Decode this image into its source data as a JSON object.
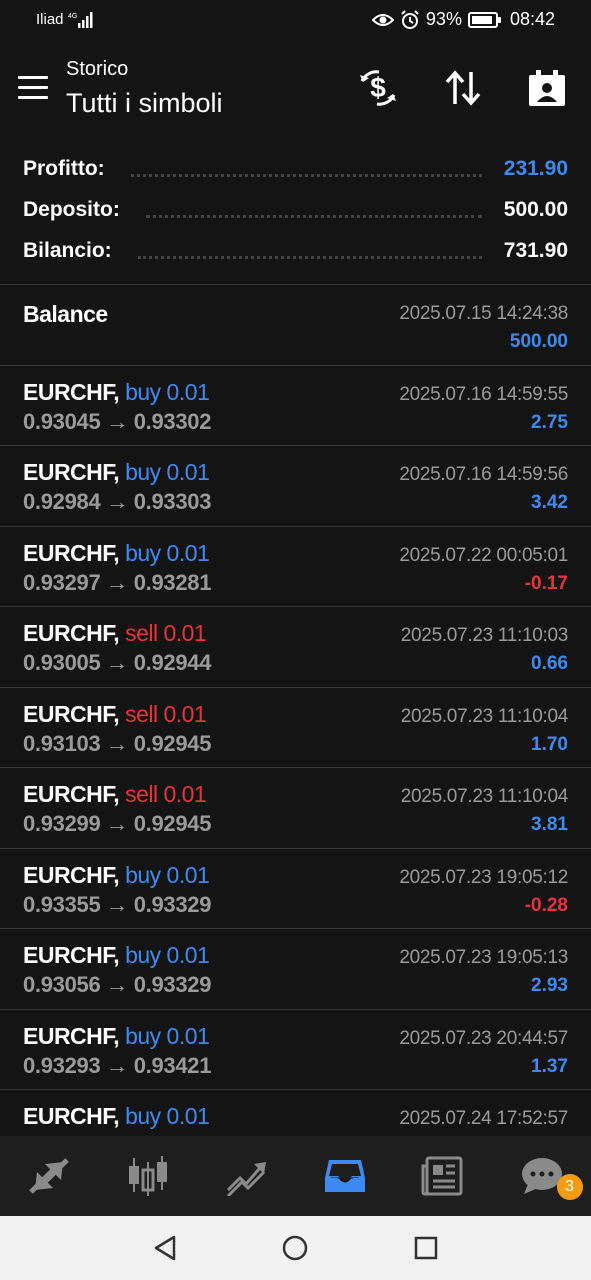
{
  "status_bar": {
    "carrier": "Iliad",
    "network": "4G",
    "battery": "93%",
    "battery_level": 0.93,
    "time": "08:42"
  },
  "header": {
    "subtitle": "Storico",
    "title": "Tutti i simboli"
  },
  "summary": [
    {
      "label": "Profitto:",
      "value": "231.90",
      "color": "#3d8bf2"
    },
    {
      "label": "Deposito:",
      "value": "500.00",
      "color": "#ffffff"
    },
    {
      "label": "Bilancio:",
      "value": "731.90",
      "color": "#ffffff"
    }
  ],
  "balance_entry": {
    "label": "Balance",
    "time": "2025.07.15 14:24:38",
    "amount": "500.00"
  },
  "deals": [
    {
      "symbol": "EURCHF,",
      "side": "buy 0.01",
      "side_type": "buy",
      "prices": "0.93045 → 0.93302",
      "time": "2025.07.16 14:59:55",
      "profit": "2.75",
      "profit_sign": "pos"
    },
    {
      "symbol": "EURCHF,",
      "side": "buy 0.01",
      "side_type": "buy",
      "prices": "0.92984 → 0.93303",
      "time": "2025.07.16 14:59:56",
      "profit": "3.42",
      "profit_sign": "pos"
    },
    {
      "symbol": "EURCHF,",
      "side": "buy 0.01",
      "side_type": "buy",
      "prices": "0.93297 → 0.93281",
      "time": "2025.07.22 00:05:01",
      "profit": "-0.17",
      "profit_sign": "neg"
    },
    {
      "symbol": "EURCHF,",
      "side": "sell 0.01",
      "side_type": "sell",
      "prices": "0.93005 → 0.92944",
      "time": "2025.07.23 11:10:03",
      "profit": "0.66",
      "profit_sign": "pos"
    },
    {
      "symbol": "EURCHF,",
      "side": "sell 0.01",
      "side_type": "sell",
      "prices": "0.93103 → 0.92945",
      "time": "2025.07.23 11:10:04",
      "profit": "1.70",
      "profit_sign": "pos"
    },
    {
      "symbol": "EURCHF,",
      "side": "sell 0.01",
      "side_type": "sell",
      "prices": "0.93299 → 0.92945",
      "time": "2025.07.23 11:10:04",
      "profit": "3.81",
      "profit_sign": "pos"
    },
    {
      "symbol": "EURCHF,",
      "side": "buy 0.01",
      "side_type": "buy",
      "prices": "0.93355 → 0.93329",
      "time": "2025.07.23 19:05:12",
      "profit": "-0.28",
      "profit_sign": "neg"
    },
    {
      "symbol": "EURCHF,",
      "side": "buy 0.01",
      "side_type": "buy",
      "prices": "0.93056 → 0.93329",
      "time": "2025.07.23 19:05:13",
      "profit": "2.93",
      "profit_sign": "pos"
    },
    {
      "symbol": "EURCHF,",
      "side": "buy 0.01",
      "side_type": "buy",
      "prices": "0.93293 → 0.93421",
      "time": "2025.07.23 20:44:57",
      "profit": "1.37",
      "profit_sign": "pos"
    },
    {
      "symbol": "EURCHF,",
      "side": "buy 0.01",
      "side_type": "buy",
      "prices": "",
      "time": "2025.07.24 17:52:57",
      "profit": "",
      "profit_sign": "pos"
    }
  ],
  "tabs": [
    {
      "name": "quotes-icon",
      "active": false
    },
    {
      "name": "chart-icon",
      "active": false
    },
    {
      "name": "trade-icon",
      "active": false
    },
    {
      "name": "history-icon",
      "active": true
    },
    {
      "name": "news-icon",
      "active": false
    },
    {
      "name": "messages-icon",
      "active": false,
      "badge": "3"
    }
  ],
  "colors": {
    "accent": "#3d8bf2",
    "loss": "#e7343a",
    "badge": "#f39c12",
    "background": "#141414"
  }
}
